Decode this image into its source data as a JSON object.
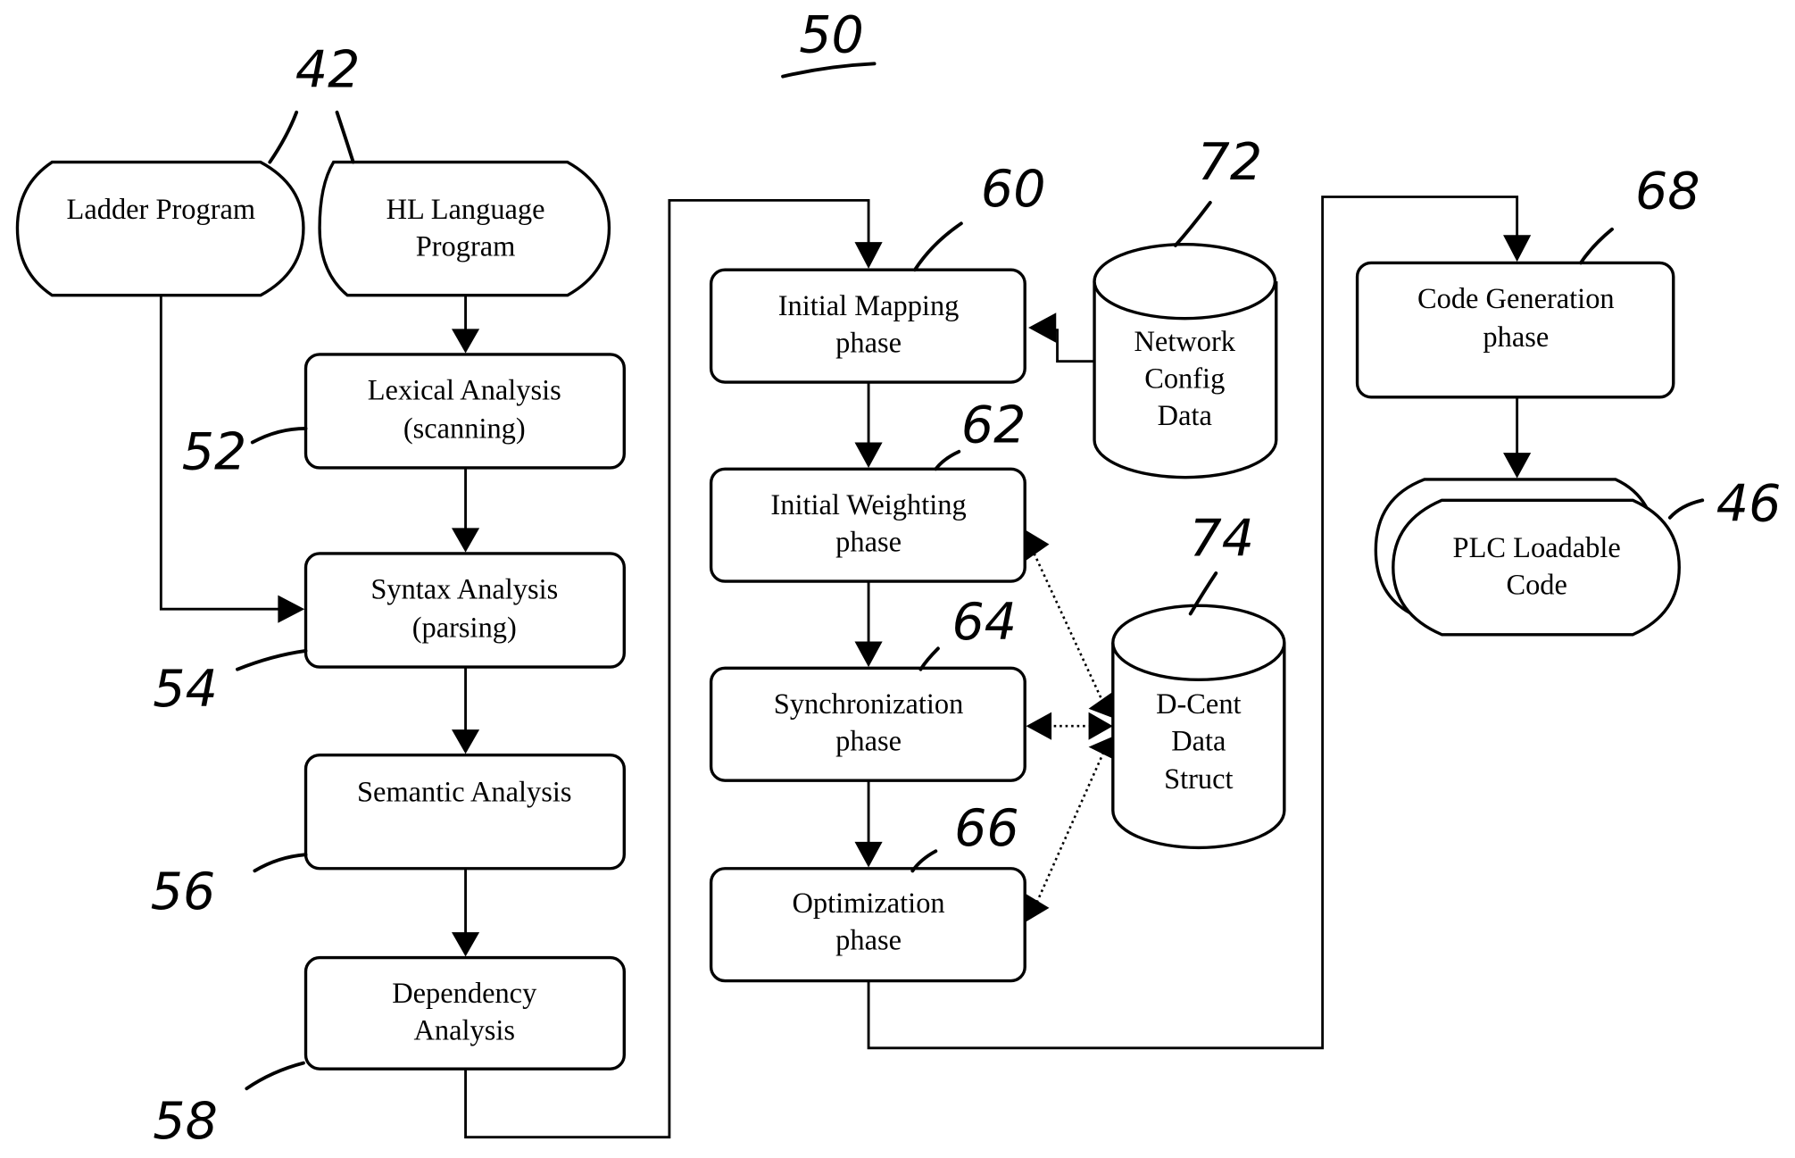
{
  "figure": {
    "number": "50",
    "type": "compiler flow diagram"
  },
  "nodes": {
    "ladder": {
      "ref": "42",
      "lines": [
        "Ladder Program"
      ]
    },
    "hl": {
      "ref": "42",
      "lines": [
        "HL Language",
        "Program"
      ]
    },
    "lexical": {
      "ref": "52",
      "lines": [
        "Lexical Analysis",
        "(scanning)"
      ]
    },
    "syntax": {
      "ref": "54",
      "lines": [
        "Syntax Analysis",
        "(parsing)"
      ]
    },
    "semantic": {
      "ref": "56",
      "lines": [
        "Semantic Analysis"
      ]
    },
    "dependency": {
      "ref": "58",
      "lines": [
        "Dependency",
        "Analysis"
      ]
    },
    "mapping": {
      "ref": "60",
      "lines": [
        "Initial Mapping",
        "phase"
      ]
    },
    "weighting": {
      "ref": "62",
      "lines": [
        "Initial Weighting",
        "phase"
      ]
    },
    "sync": {
      "ref": "64",
      "lines": [
        "Synchronization",
        "phase"
      ]
    },
    "optimization": {
      "ref": "66",
      "lines": [
        "Optimization",
        "phase"
      ]
    },
    "codegen": {
      "ref": "68",
      "lines": [
        "Code Generation",
        "phase"
      ]
    },
    "plc": {
      "ref": "46",
      "lines": [
        "PLC  Loadable",
        "Code"
      ]
    },
    "netconfig": {
      "ref": "72",
      "lines": [
        "Network",
        "Config",
        "Data"
      ]
    },
    "dcent": {
      "ref": "74",
      "lines": [
        "D-Cent",
        "Data",
        "Struct"
      ]
    }
  },
  "edges": [
    {
      "from": "hl",
      "to": "lexical",
      "style": "solid"
    },
    {
      "from": "lexical",
      "to": "syntax",
      "style": "solid"
    },
    {
      "from": "ladder",
      "to": "syntax",
      "style": "solid"
    },
    {
      "from": "syntax",
      "to": "semantic",
      "style": "solid"
    },
    {
      "from": "semantic",
      "to": "dependency",
      "style": "solid"
    },
    {
      "from": "dependency",
      "to": "mapping",
      "style": "solid"
    },
    {
      "from": "netconfig",
      "to": "mapping",
      "style": "solid"
    },
    {
      "from": "mapping",
      "to": "weighting",
      "style": "solid"
    },
    {
      "from": "weighting",
      "to": "sync",
      "style": "solid"
    },
    {
      "from": "sync",
      "to": "optimization",
      "style": "solid"
    },
    {
      "from": "optimization",
      "to": "codegen",
      "style": "solid"
    },
    {
      "from": "codegen",
      "to": "plc",
      "style": "solid"
    },
    {
      "from": "dcent",
      "to": "weighting",
      "style": "dotted",
      "bidirectional": true
    },
    {
      "from": "dcent",
      "to": "sync",
      "style": "dotted",
      "bidirectional": true
    },
    {
      "from": "dcent",
      "to": "optimization",
      "style": "dotted",
      "bidirectional": true
    }
  ]
}
